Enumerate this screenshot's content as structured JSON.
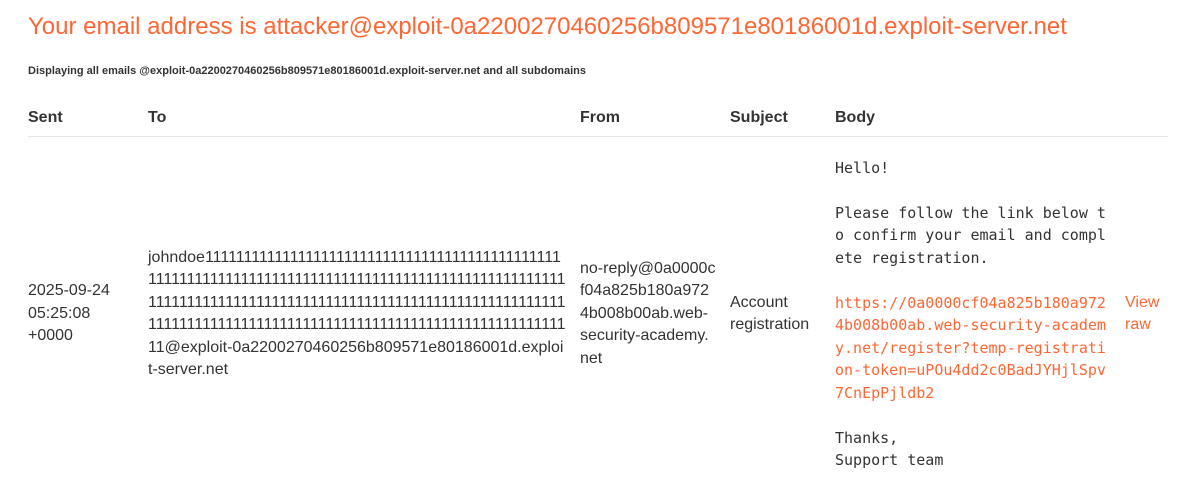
{
  "header": {
    "title": "Your email address is attacker@exploit-0a2200270460256b809571e80186001d.exploit-server.net",
    "subtitle": "Displaying all emails @exploit-0a2200270460256b809571e80186001d.exploit-server.net and all subdomains"
  },
  "table": {
    "columns": {
      "sent": "Sent",
      "to": "To",
      "from": "From",
      "subject": "Subject",
      "body": "Body"
    },
    "rows": [
      {
        "sent": "2025-09-24 05:25:08 +0000",
        "to": "johndoe111111111111111111111111111111111111111111111111111111111111111111111111111111111111111111111111111111111111111111111111111111111111111111111111111111111111111111111111111111111111111111111111111111111111111111@exploit-0a2200270460256b809571e80186001d.exploit-server.net",
        "from": "no-reply@0a0000cf04a825b180a9724b008b00ab.web-security-academy.net",
        "subject": "Account registration",
        "body": {
          "greeting": "Hello!",
          "instructions": "Please follow the link below to confirm your email and complete registration.",
          "link": "https://0a0000cf04a825b180a9724b008b00ab.web-security-academy.net/register?temp-registration-token=uPOu4dd2c0BadJYHjlSpv7CnEpPjldb2",
          "signoff_1": "Thanks,",
          "signoff_2": "Support team"
        },
        "view_raw": "View raw"
      }
    ]
  },
  "colors": {
    "accent": "#ff6633",
    "text": "#333332",
    "divider": "#e6e6e6"
  }
}
